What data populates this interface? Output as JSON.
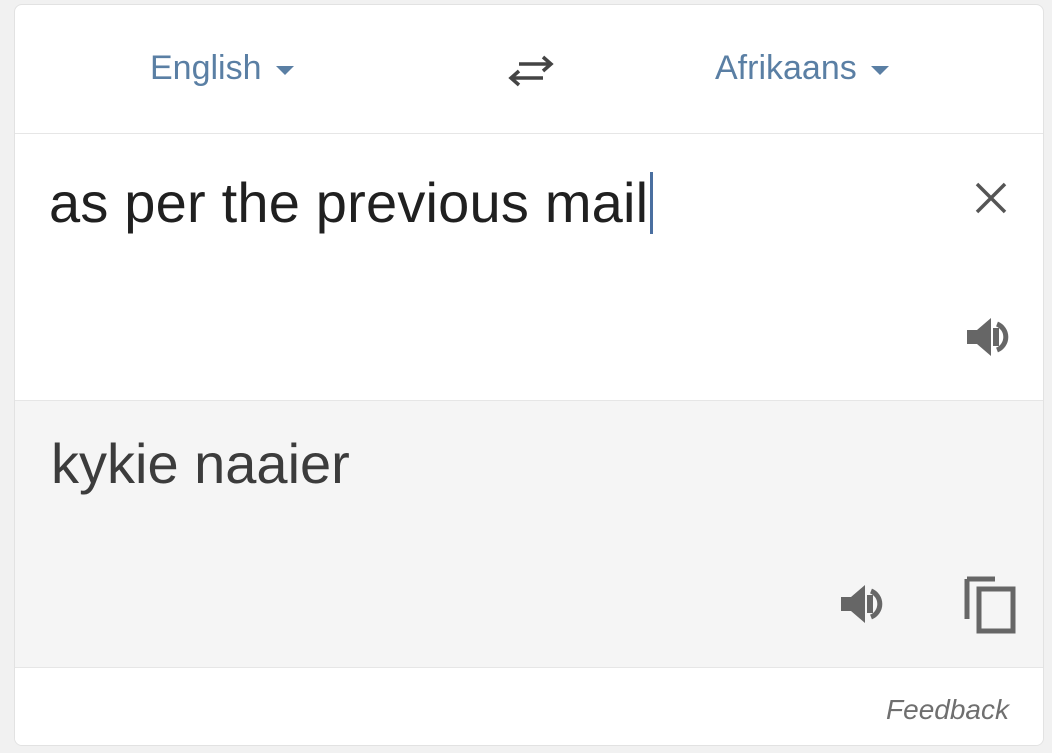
{
  "languages": {
    "source": "English",
    "target": "Afrikaans"
  },
  "source": {
    "text": "as per the previous mail"
  },
  "translation": {
    "text": "kykie naaier"
  },
  "footer": {
    "feedback_label": "Feedback"
  },
  "icons": {
    "swap": "swap-languages-icon",
    "clear": "close-icon",
    "listen": "speaker-icon",
    "copy": "copy-icon"
  },
  "colors": {
    "accent": "#5a7fa4",
    "text_primary": "#202020",
    "translation_bg": "#f5f5f5"
  }
}
